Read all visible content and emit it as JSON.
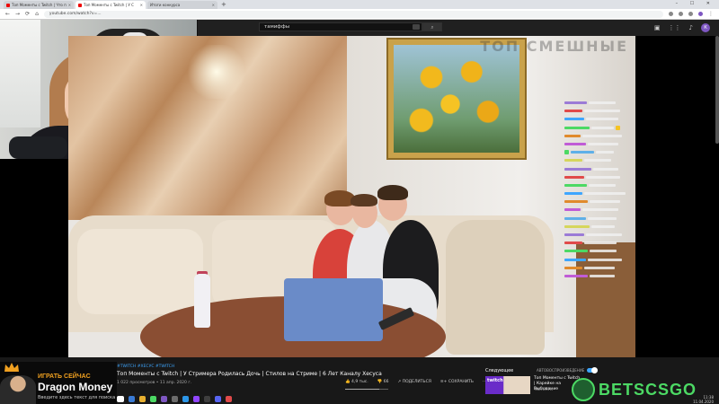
{
  "browser": {
    "tabs": [
      {
        "label": "Топ Моменты с Twitch | Что п",
        "active": false
      },
      {
        "label": "Топ Моменты с Twitch | У С",
        "active": true
      },
      {
        "label": "Итоги конкурса",
        "active": false
      }
    ],
    "new_tab": "+",
    "window_controls": "– ☐ ✕",
    "url": "youtube.com/watch?v=..."
  },
  "youtube": {
    "search_value": "тамиффы",
    "avatar_letter": "К"
  },
  "video": {
    "watermark": "ТОП СМЕШНЫЕ"
  },
  "promo": {
    "small": "ИГРАТЬ СЕЙЧАС",
    "big": "Dragon Money",
    "sub": "Введите здесь текст для поиска"
  },
  "info": {
    "tags": "#TWITCH #ХЕСУС #TWITCH",
    "title": "Топ Моменты с Twitch | У Стримера Родилась Дочь | Стилов на Стриме | 6 Лет Каналу Хесуса",
    "meta": "1 022 просмотров • 11 апр. 2020 г.",
    "likes": "4,9 тыс.",
    "dislikes": "66",
    "share": "ПОДЕЛИТЬСЯ",
    "save": "СОХРАНИТЬ",
    "like_ratio": 0.8
  },
  "upnext": {
    "label": "Следующее",
    "autoplay": "АВТОВОСПРОИЗВЕДЕНИЕ",
    "thumb_text": "twitch",
    "title": "Топ Моменты с Twitch | Карейке на Выбывание",
    "channel": "TWITCHFM"
  },
  "brand": {
    "logo_text": "BETSCSGO",
    "color": "#4cd964"
  },
  "clock": {
    "time": "11:38",
    "date": "11.04.2020"
  },
  "colors": {
    "youtube_bg": "#181818",
    "accent": "#3ea6ff",
    "promo_orange": "#f0a020"
  }
}
